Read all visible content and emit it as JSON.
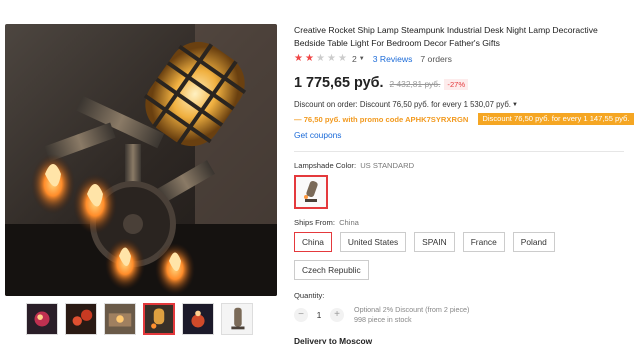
{
  "gallery": {
    "main_image": "rocket-lamp-photo",
    "thumbnails": [
      {
        "name": "rocket-lamp-thumb-1",
        "active": false
      },
      {
        "name": "rocket-lamp-thumb-2",
        "active": false
      },
      {
        "name": "rocket-lamp-thumb-3",
        "active": false
      },
      {
        "name": "rocket-lamp-thumb-4",
        "active": true
      },
      {
        "name": "rocket-lamp-thumb-5",
        "active": false
      },
      {
        "name": "rocket-lamp-thumb-6",
        "active": false
      }
    ]
  },
  "product": {
    "title": "Creative Rocket Ship Lamp Steampunk Industrial Desk Night Lamp Decoractive Bedside Table Light For Bedroom Decor Father's Gifts",
    "rating": {
      "stars_filled": 2,
      "stars_total": 5,
      "votes": "2",
      "reviews": "3 Reviews",
      "orders": "7 orders"
    },
    "price": "1 775,65 руб.",
    "old_price": "2 432,81 руб.",
    "discount_percent": "-27%",
    "discount_on_order": "Discount on order: Discount 76,50 руб. for every 1 530,07 руб.",
    "promo_text": "— 76,50 руб. with promo code APHK7SYRXRGN",
    "promo_button": "Discount 76,50 руб. for every 1 147,55 руб.",
    "get_coupons": "Get coupons"
  },
  "lampshade": {
    "label": "Lampshade Color:",
    "value": "US STANDARD"
  },
  "ships_from": {
    "label": "Ships From:",
    "value": "China",
    "options": [
      "China",
      "United States",
      "SPAIN",
      "France",
      "Poland",
      "Czech Republic"
    ],
    "selected": "China"
  },
  "quantity": {
    "label": "Quantity:",
    "value": "1",
    "minus": "−",
    "plus": "+",
    "note_discount": "Optional 2% Discount (from 2 piece)",
    "note_stock": "998 piece in stock"
  },
  "delivery": "Delivery to Moscow",
  "colors": {
    "accent": "#e4393c",
    "link": "#1a6ad8",
    "promo": "#f5a623",
    "star": "#f04646"
  }
}
